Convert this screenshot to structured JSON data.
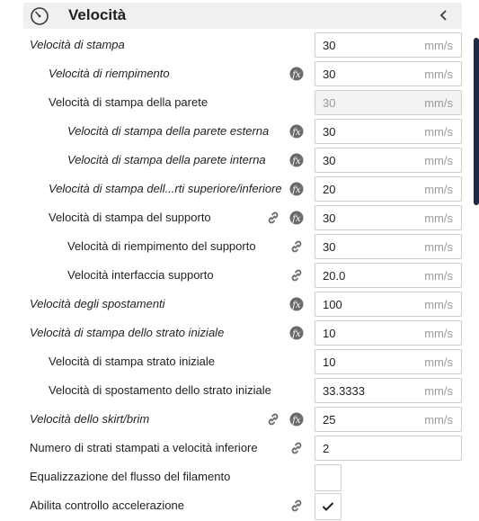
{
  "section": {
    "title": "Velocità"
  },
  "settings": [
    {
      "label": "Velocità di stampa",
      "value": "30",
      "unit": "mm/s"
    },
    {
      "label": "Velocità di riempimento",
      "value": "30",
      "unit": "mm/s"
    },
    {
      "label": "Velocità di stampa della parete",
      "value": "30",
      "unit": "mm/s"
    },
    {
      "label": "Velocità di stampa della parete esterna",
      "value": "30",
      "unit": "mm/s"
    },
    {
      "label": "Velocità di stampa della parete interna",
      "value": "30",
      "unit": "mm/s"
    },
    {
      "label": "Velocità di stampa dell...rti superiore/inferiore",
      "value": "20",
      "unit": "mm/s"
    },
    {
      "label": "Velocità di stampa del supporto",
      "value": "30",
      "unit": "mm/s"
    },
    {
      "label": "Velocità di riempimento del supporto",
      "value": "30",
      "unit": "mm/s"
    },
    {
      "label": "Velocità interfaccia supporto",
      "value": "20.0",
      "unit": "mm/s"
    },
    {
      "label": "Velocità degli spostamenti",
      "value": "100",
      "unit": "mm/s"
    },
    {
      "label": "Velocità di stampa dello strato iniziale",
      "value": "10",
      "unit": "mm/s"
    },
    {
      "label": "Velocità di stampa strato iniziale",
      "value": "10",
      "unit": "mm/s"
    },
    {
      "label": "Velocità di spostamento dello strato iniziale",
      "value": "33.3333",
      "unit": "mm/s"
    },
    {
      "label": "Velocità dello skirt/brim",
      "value": "25",
      "unit": "mm/s"
    },
    {
      "label": "Numero di strati stampati a velocità inferiore",
      "value": "2"
    },
    {
      "label": "Equalizzazione del flusso del filamento",
      "checked": false
    },
    {
      "label": "Abilita controllo accelerazione",
      "checked": true
    }
  ],
  "colors": {
    "scrollbar": "#1d2a45",
    "header_bg": "#f0f0f0",
    "icon_badge": "#6b6b6b"
  }
}
